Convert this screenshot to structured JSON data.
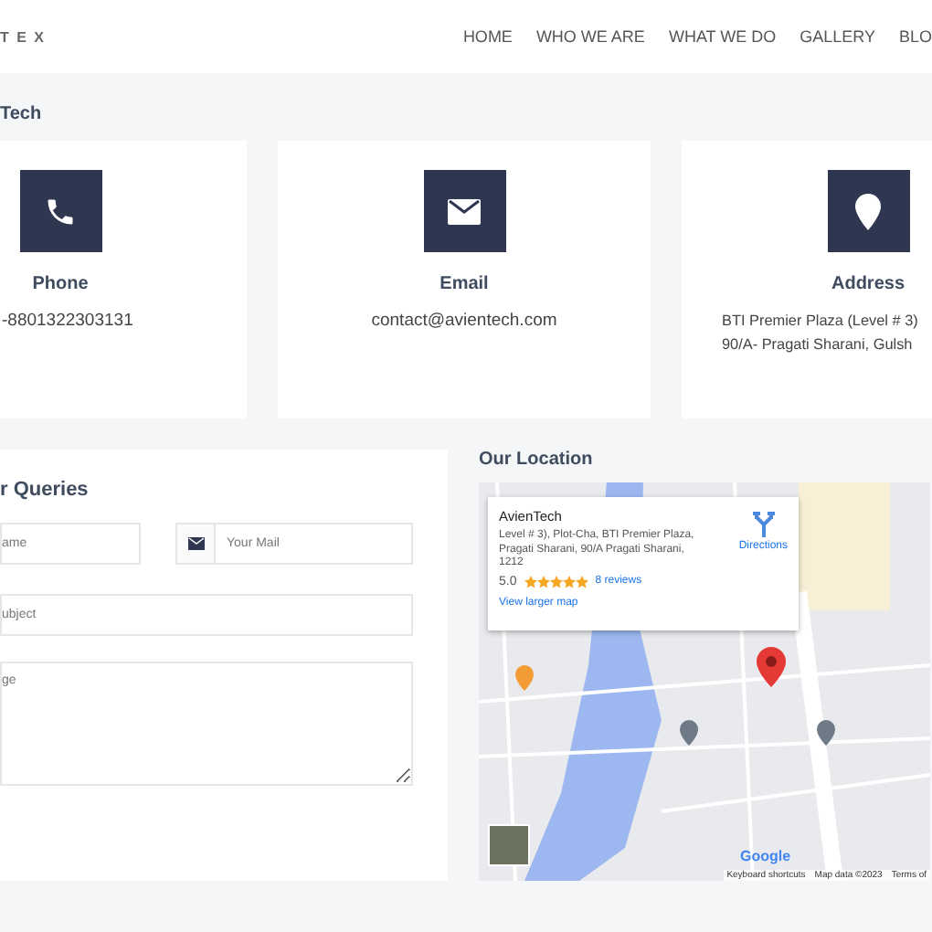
{
  "header": {
    "logo": "T E X",
    "nav": [
      {
        "label": "HOME",
        "selected": false
      },
      {
        "label": "WHO WE ARE",
        "selected": false
      },
      {
        "label": "WHAT WE DO",
        "selected": false
      },
      {
        "label": "GALLERY",
        "selected": false
      },
      {
        "label": "BLO",
        "selected": false
      }
    ]
  },
  "section_title": "Tech",
  "contact_cards": [
    {
      "kind": "phone",
      "title": "Phone",
      "lines": [
        "-8801322303131"
      ]
    },
    {
      "kind": "email",
      "title": "Email",
      "lines": [
        "contact@avientech.com"
      ]
    },
    {
      "kind": "address",
      "title": "Address",
      "lines": [
        "BTI Premier Plaza (Level # 3)",
        "90/A- Pragati Sharani, Gulsh"
      ]
    }
  ],
  "form": {
    "title": "r Queries",
    "name_placeholder": "ame",
    "mail_placeholder": "Your Mail",
    "subject_placeholder": "ubject",
    "message_placeholder": "ge"
  },
  "location": {
    "title": "Our Location",
    "info_card": {
      "name": "AvienTech",
      "address": "Level # 3), Plot-Cha, BTI Premier Plaza, Pragati Sharani, 90/A Pragati Sharani, 1212",
      "rating": "5.0",
      "stars": 5,
      "reviews": "8 reviews",
      "directions": "Directions",
      "larger_map": "View larger map"
    },
    "logo": "Google",
    "footer": [
      "Keyboard shortcuts",
      "Map data ©2023",
      "Terms of"
    ]
  }
}
